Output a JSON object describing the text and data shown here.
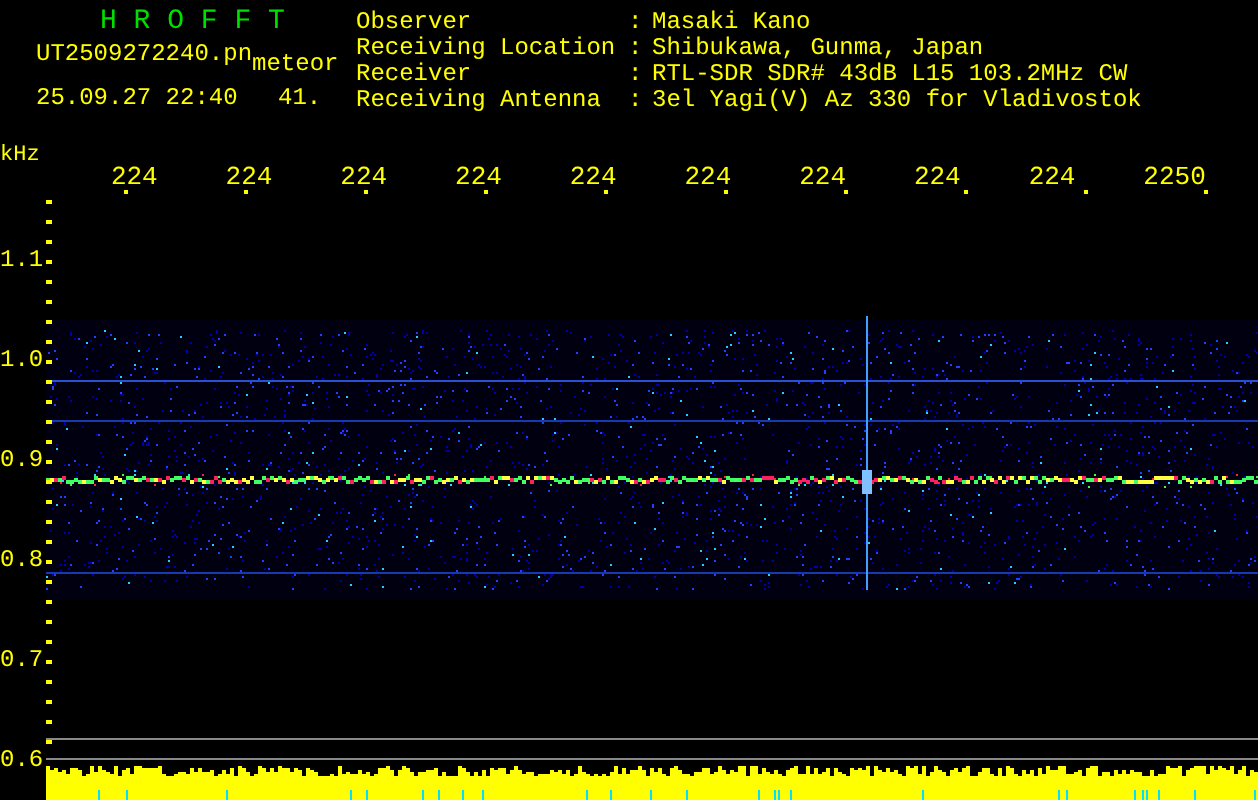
{
  "app_title": "H R O F F T",
  "file": {
    "name": "UT2509272240.pn",
    "tag": "meteor",
    "timestamp": "25.09.27 22:40",
    "value": "41."
  },
  "info": [
    {
      "label": "Observer",
      "value": "Masaki Kano"
    },
    {
      "label": "Receiving Location",
      "value": "Shibukawa, Gunma, Japan"
    },
    {
      "label": "Receiver",
      "value": "RTL-SDR SDR# 43dB L15 103.2MHz CW"
    },
    {
      "label": "Receiving Antenna",
      "value": "3el Yagi(V) Az 330 for Vladivostok"
    }
  ],
  "separator": ":",
  "x_axis": {
    "unit": "kHz",
    "labels": [
      "224",
      "224",
      "224",
      "224",
      "224",
      "224",
      "224",
      "224",
      "224",
      "2250"
    ]
  },
  "y_axis": {
    "labels": [
      "1.1",
      "1.0",
      "0.9",
      "0.8",
      "0.7",
      "0.6"
    ]
  }
}
